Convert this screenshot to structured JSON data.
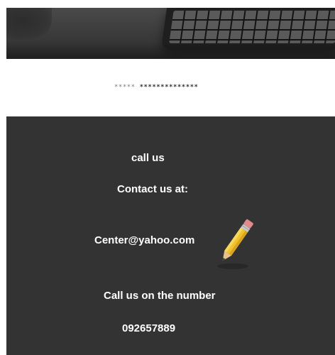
{
  "header": {
    "masked_text_light": "*****",
    "masked_text_dark": "**************"
  },
  "contact": {
    "call_us": "call us",
    "contact_us_at": "Contact us at:",
    "email": "Center@yahoo.com",
    "call_number_label": "Call us on the number",
    "phone": "092657889"
  },
  "icons": {
    "hero": "keyboard-photo",
    "pencil": "pencil-icon"
  },
  "colors": {
    "dark_section": "#333333",
    "text": "#ffffff"
  }
}
